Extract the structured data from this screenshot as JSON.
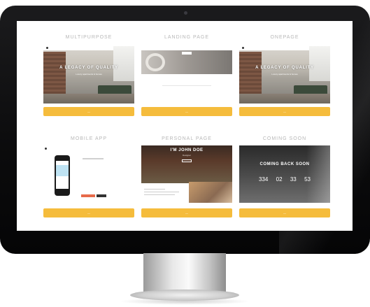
{
  "screen": {
    "cards": [
      {
        "title": "MULTIPURPOSE",
        "hero_title": "A LEGACY OF QUALITY",
        "hero_sub": "Luxury apartments & homes",
        "button": "—"
      },
      {
        "title": "LANDING PAGE",
        "button": "—"
      },
      {
        "title": "ONEPAGE",
        "hero_title": "A LEGACY OF QUALITY",
        "hero_sub": "Luxury apartments & homes",
        "button": "—"
      },
      {
        "title": "MOBILE APP",
        "button": "—"
      },
      {
        "title": "PERSONAL PAGE",
        "name": "I'M JOHN DOE",
        "sub": "Designer",
        "button": "—"
      },
      {
        "title": "COMING SOON",
        "heading": "COMING BACK SOON",
        "countdown": [
          "334",
          "02",
          "33",
          "53"
        ],
        "button": "—"
      }
    ]
  },
  "colors": {
    "accent": "#f5bc3c"
  }
}
